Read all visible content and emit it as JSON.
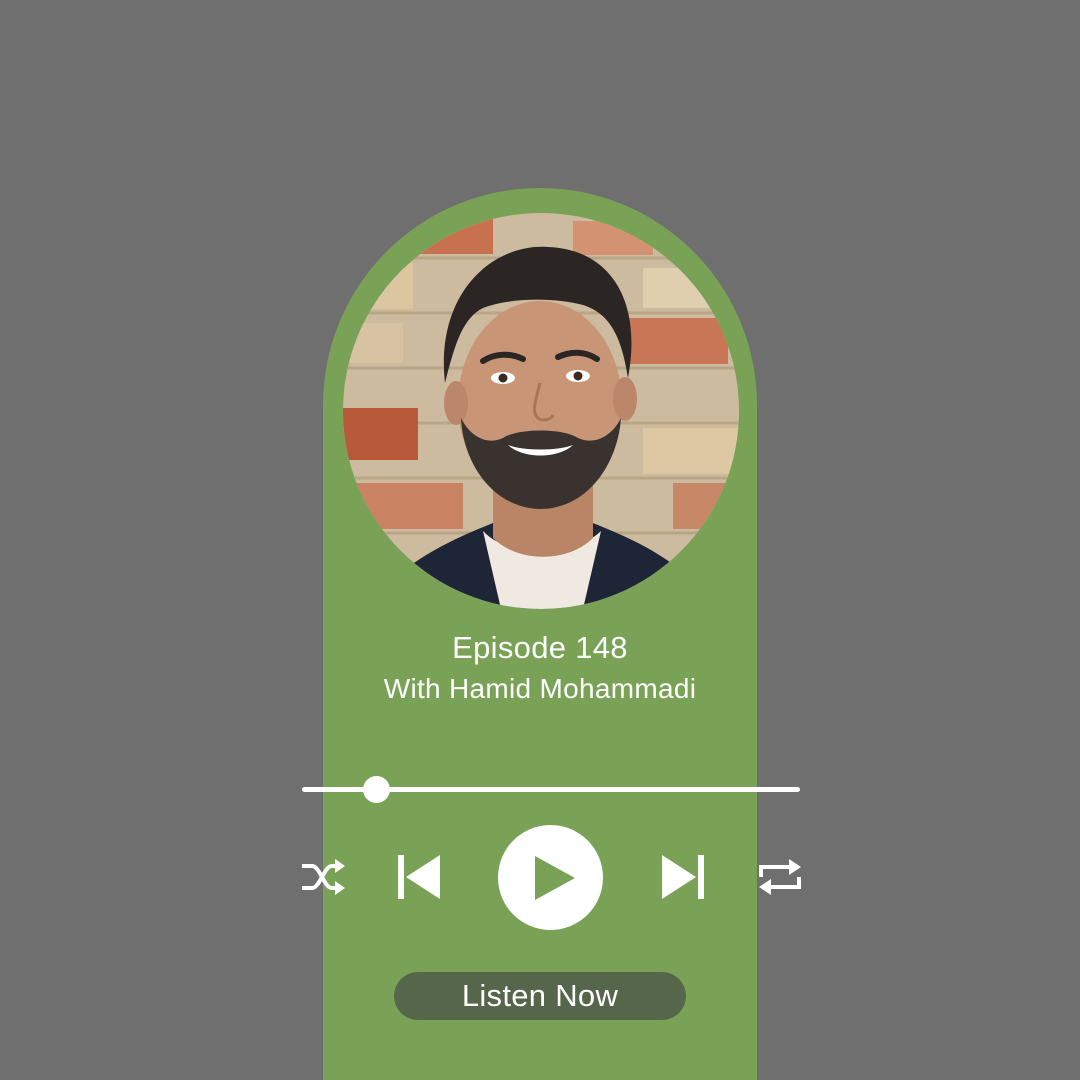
{
  "episode": {
    "title": "Episode 148",
    "subtitle": "With Hamid Mohammadi"
  },
  "player": {
    "progress_fraction": 0.15,
    "controls": [
      "shuffle-icon",
      "skip-previous-icon",
      "play-icon",
      "skip-next-icon",
      "repeat-icon"
    ]
  },
  "cta": {
    "label": "Listen Now"
  },
  "colors": {
    "background": "#6f6f6f",
    "card": "#7aa257",
    "button": "#56664a",
    "foreground": "#ffffff"
  }
}
